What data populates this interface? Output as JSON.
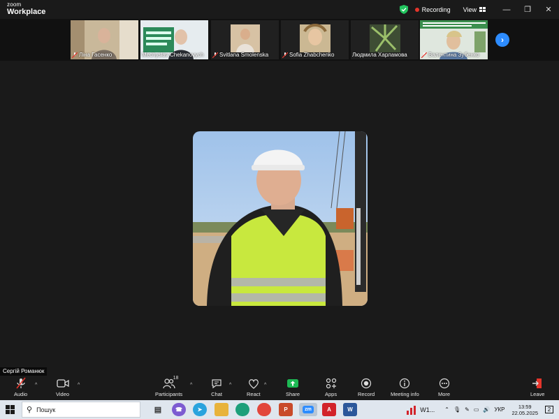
{
  "app": {
    "brand_small": "zoom",
    "brand_big": "Workplace"
  },
  "titlebar": {
    "recording_label": "Recording",
    "view_label": "View"
  },
  "participants": [
    {
      "name": "Ліна Гасенко",
      "muted": true
    },
    {
      "name": "Mechyslav Chekanovych",
      "muted": false
    },
    {
      "name": "Svitlana Smolenska",
      "muted": true
    },
    {
      "name": "Sofia Zhabchenko",
      "muted": true
    },
    {
      "name": "Людмила Харламова",
      "muted": false
    },
    {
      "name": "Валентина Зубенко",
      "muted": true
    }
  ],
  "active_speaker": {
    "name": "Сергій Романюк"
  },
  "controls": {
    "audio": "Audio",
    "video": "Video",
    "participants": "Participants",
    "participants_count": "18",
    "chat": "Chat",
    "react": "React",
    "share": "Share",
    "apps": "Apps",
    "record": "Record",
    "meeting_info": "Meeting info",
    "more": "More",
    "leave": "Leave"
  },
  "taskbar": {
    "search_placeholder": "Пошук",
    "tray_app_label": "W1...",
    "language": "УКР",
    "time": "13:59",
    "date": "22.05.2025",
    "notification_count": "2"
  },
  "colors": {
    "accent": "#2d8cff",
    "share_green": "#1db954",
    "leave_red": "#e5352b",
    "stage_bg": "#1a1a1a"
  }
}
